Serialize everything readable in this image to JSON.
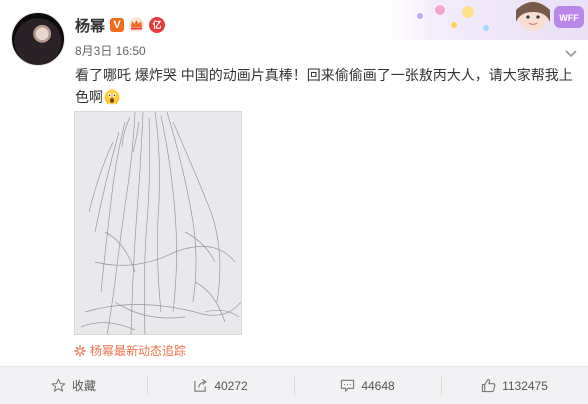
{
  "author": {
    "name": "杨幂",
    "verified_badge": "V",
    "level_badge": "亿",
    "avatar_icon": "avatar"
  },
  "post": {
    "time": "8月3日 16:50",
    "text": "看了哪吒 爆炸哭 中国的动画片真棒！回来偷偷画了一张敖丙大人，请大家帮我上色啊",
    "emoji_icon": "scared-face-emoji"
  },
  "follow_link": "杨幂最新动态追踪",
  "actions": {
    "favorite_label": "收藏",
    "repost_count": "40272",
    "comment_count": "44648",
    "like_count": "1132475"
  },
  "colors": {
    "accent": "#eb7350",
    "verified": "#f26b1d",
    "level": "#e8383d"
  }
}
